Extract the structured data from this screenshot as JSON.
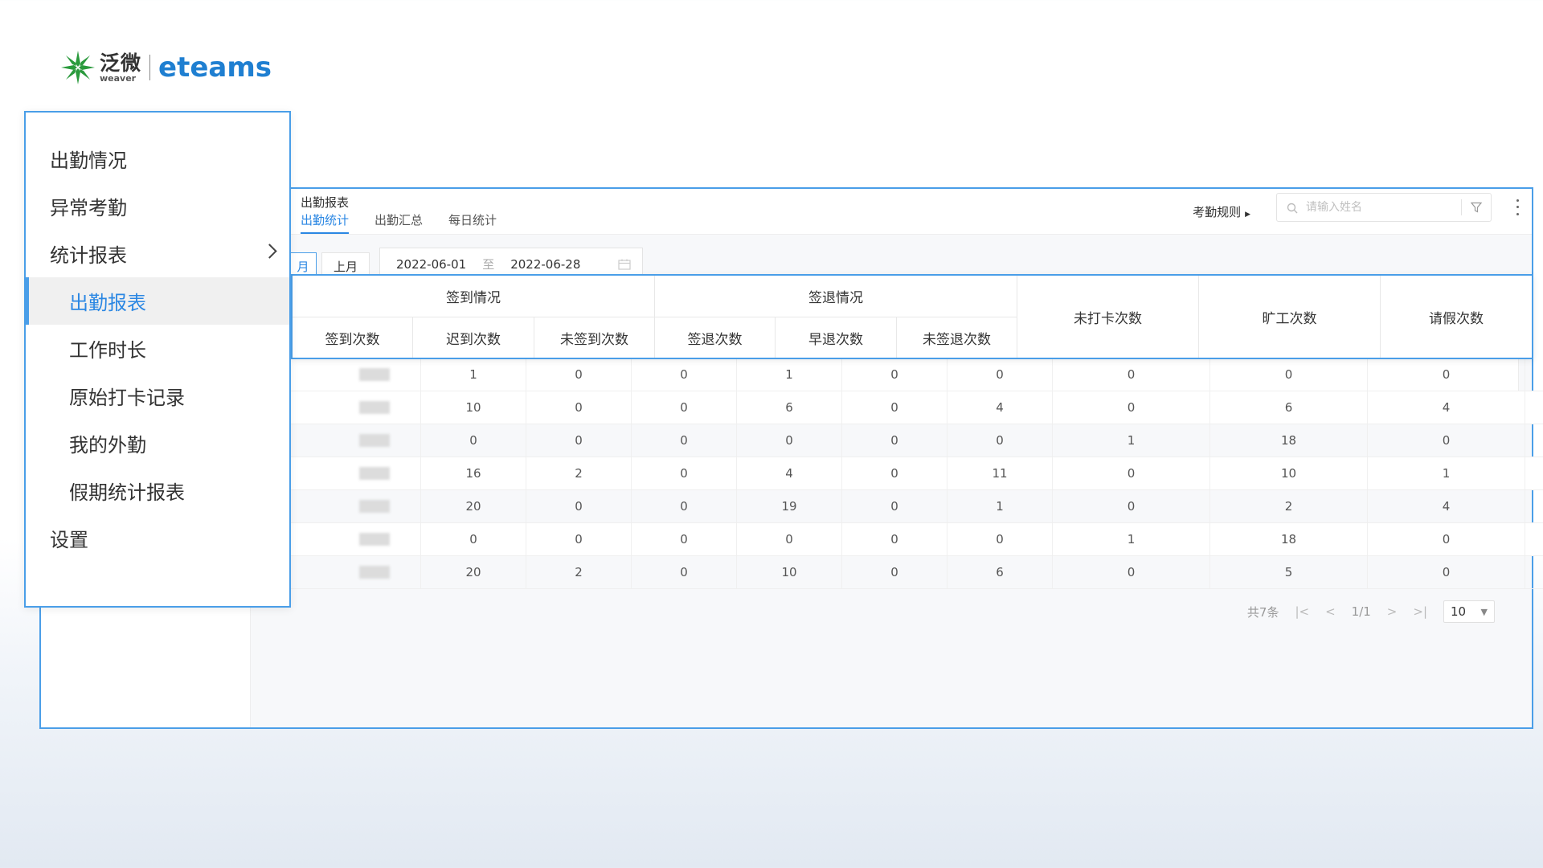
{
  "logo": {
    "cn": "泛微",
    "en_small": "weaver",
    "brand": "eteams"
  },
  "menu": {
    "items": [
      {
        "label": "出勤情况"
      },
      {
        "label": "异常考勤"
      },
      {
        "label": "统计报表"
      },
      {
        "label": "出勤报表"
      },
      {
        "label": "工作时长"
      },
      {
        "label": "原始打卡记录"
      },
      {
        "label": "我的外勤"
      },
      {
        "label": "假期统计报表"
      },
      {
        "label": "设置"
      }
    ]
  },
  "header": {
    "title": "出勤报表",
    "tabs": [
      {
        "label": "出勤统计"
      },
      {
        "label": "出勤汇总"
      },
      {
        "label": "每日统计"
      }
    ],
    "rule_label": "考勤规则",
    "search_placeholder": "请输入姓名"
  },
  "period": {
    "current_label": "月",
    "last_label": "上月",
    "start_date": "2022-06-01",
    "to_label": "至",
    "end_date": "2022-06-28"
  },
  "table": {
    "groups": [
      {
        "label": "签到情况",
        "cols": [
          "签到次数",
          "迟到次数",
          "未签到次数"
        ]
      },
      {
        "label": "签退情况",
        "cols": [
          "签退次数",
          "早退次数",
          "未签退次数"
        ]
      }
    ],
    "single_cols": [
      "未打卡次数",
      "旷工次数",
      "请假次数"
    ],
    "rows": [
      [
        "1",
        "0",
        "0",
        "1",
        "0",
        "0",
        "0",
        "0",
        "0"
      ],
      [
        "10",
        "0",
        "0",
        "6",
        "0",
        "4",
        "0",
        "6",
        "4"
      ],
      [
        "0",
        "0",
        "0",
        "0",
        "0",
        "0",
        "1",
        "18",
        "0"
      ],
      [
        "16",
        "2",
        "0",
        "4",
        "0",
        "11",
        "0",
        "10",
        "1"
      ],
      [
        "20",
        "0",
        "0",
        "19",
        "0",
        "1",
        "0",
        "2",
        "4"
      ],
      [
        "0",
        "0",
        "0",
        "0",
        "0",
        "0",
        "1",
        "18",
        "0"
      ],
      [
        "20",
        "2",
        "0",
        "10",
        "0",
        "6",
        "0",
        "5",
        "0"
      ]
    ]
  },
  "pager": {
    "total": "共7条",
    "page": "1/1",
    "size": "10"
  },
  "colors": {
    "accent": "#2b87e3",
    "highlight_border": "#4a9ee8",
    "brand": "#1f7fd1",
    "logo_green": "#2a9a3c"
  }
}
